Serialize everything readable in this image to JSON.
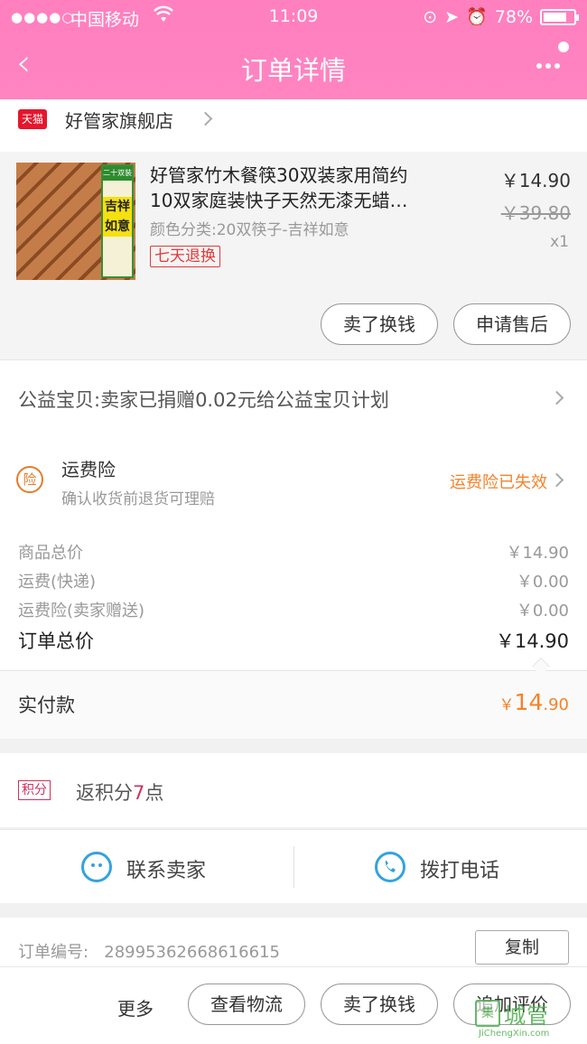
{
  "status_bar": {
    "carrier": "中国移动",
    "time": "11:09",
    "battery": "78%",
    "battery_level": 0.78
  },
  "nav": {
    "title": "订单详情"
  },
  "shop": {
    "badge": "天猫",
    "name": "好管家旗舰店"
  },
  "product": {
    "title_line1": "好管家竹木餐筷30双装家用简约",
    "title_line2": "10双家庭装快子天然无漆无蜡…",
    "sku": "颜色分类:20双筷子-吉祥如意",
    "tag": "七天退换",
    "price": "￥14.90",
    "original_price": "￥39.80",
    "qty": "x1",
    "thumb_text_top": "二十双装",
    "thumb_text_main": "吉祥如意",
    "btn_sell": "卖了换钱",
    "btn_after_sale": "申请售后"
  },
  "charity": {
    "text": "公益宝贝:卖家已捐赠0.02元给公益宝贝计划"
  },
  "insurance": {
    "icon_text": "险",
    "title": "运费险",
    "subtitle": "确认收货前退货可理赔",
    "status": "运费险已失效",
    "status_color": "#f5822a"
  },
  "summary": {
    "rows": [
      {
        "label": "商品总价",
        "value": "￥14.90"
      },
      {
        "label": "运费(快递)",
        "value": "￥0.00"
      },
      {
        "label": "运费险(卖家赠送)",
        "value": "￥0.00"
      }
    ],
    "total_label": "订单总价",
    "total_value": "￥14.90",
    "paid_label": "实付款",
    "paid_symbol": "￥",
    "paid_int": "14",
    "paid_dec": ".90"
  },
  "points": {
    "badge": "积分",
    "prefix": "返积分",
    "num": "7",
    "suffix": "点"
  },
  "contact": {
    "seller": "联系卖家",
    "phone": "拨打电话"
  },
  "order": {
    "label": "订单编号:",
    "number": "28995362668616615",
    "copy": "复制"
  },
  "bottom_bar": {
    "more": "更多",
    "logistics": "查看物流",
    "sell": "卖了换钱",
    "review": "追加评价"
  },
  "watermark": {
    "cn": "城管",
    "icon": "集",
    "en": "JiChengXin.com"
  },
  "colors": {
    "header": "#ff80bf",
    "accent": "#f5822a",
    "tmall": "#e5162d",
    "points": "#d0325c",
    "contact_icon": "#35a2e0"
  }
}
